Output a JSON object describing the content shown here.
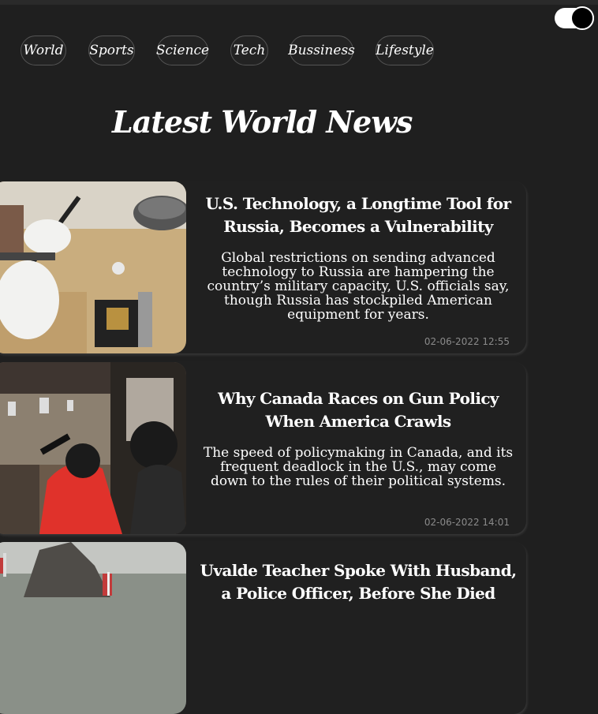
{
  "theme_toggle": {
    "state": "on"
  },
  "nav": {
    "items": [
      "World",
      "Sports",
      "Science",
      "Tech",
      "Bussiness",
      "Lifestyle"
    ]
  },
  "page": {
    "heading": "Latest World News"
  },
  "articles": [
    {
      "title": "U.S. Technology, a Longtime Tool for Russia, Becomes a Vulnerability",
      "description": "Global restrictions on sending advanced technology to Russia are hampering the country’s military capacity, U.S. officials say, though Russia has stockpiled American equipment for years.",
      "date": "02-06-2022 12:55",
      "image": "soldering-workbench-photo"
    },
    {
      "title": "Why Canada Races on Gun Policy When America Crawls",
      "description": "The speed of policymaking in Canada, and its frequent deadlock in the U.S., may come down to the rules of their political systems.",
      "date": "02-06-2022 14:01",
      "image": "shooting-range-photo"
    },
    {
      "title": "Uvalde Teacher Spoke With Husband, a Police Officer, Before She Died",
      "description": "",
      "date": "",
      "image": "flags-outdoor-photo"
    }
  ]
}
